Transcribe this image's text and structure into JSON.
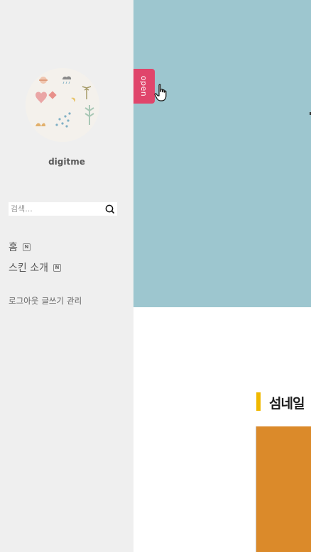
{
  "sidebar": {
    "blog_name": "digitme",
    "search": {
      "placeholder": "검색...",
      "icon": "search-icon"
    },
    "nav": [
      {
        "label": "홈",
        "badge": "N"
      },
      {
        "label": "스킨 소개",
        "badge": "N"
      }
    ],
    "footer": {
      "logout": "로그아웃",
      "write": "글쓰기",
      "manage": "관리"
    }
  },
  "hero": {
    "open_tab_label": "open"
  },
  "content": {
    "section_title": "섬네일"
  },
  "colors": {
    "sidebar_bg": "#efefef",
    "hero_bg": "#9dc6cf",
    "open_tab": "#e0456b",
    "section_accent": "#f0b800",
    "thumbnail": "#db8a2a"
  }
}
